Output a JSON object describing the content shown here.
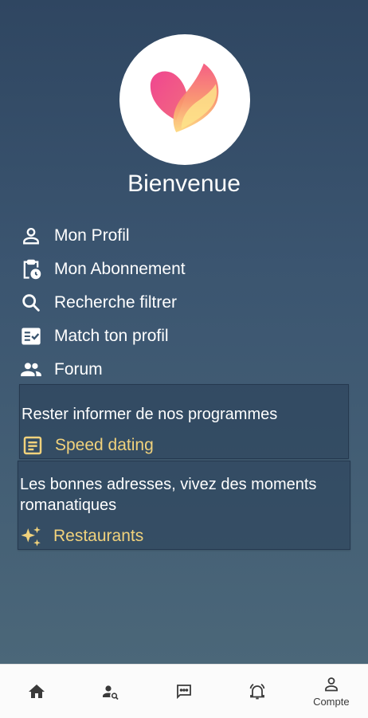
{
  "header": {
    "welcome": "Bienvenue"
  },
  "menu": {
    "items": [
      {
        "label": "Mon Profil",
        "icon": "person-icon"
      },
      {
        "label": "Mon Abonnement",
        "icon": "clipboard-clock-icon"
      },
      {
        "label": "Recherche filtrer",
        "icon": "search-icon"
      },
      {
        "label": "Match ton profil",
        "icon": "fact-check-icon"
      },
      {
        "label": "Forum",
        "icon": "group-icon"
      }
    ]
  },
  "cards": [
    {
      "text": "Rester informer de nos programmes",
      "link": "Speed dating",
      "icon": "article-icon"
    },
    {
      "text": "Les bonnes adresses, vivez des moments romanatiques",
      "link": "Restaurants",
      "icon": "sparkles-icon"
    }
  ],
  "bottom_nav": {
    "items": [
      {
        "icon": "home-icon",
        "label": ""
      },
      {
        "icon": "person-search-icon",
        "label": ""
      },
      {
        "icon": "chat-icon",
        "label": ""
      },
      {
        "icon": "alarm-bell-icon",
        "label": ""
      },
      {
        "icon": "account-icon",
        "label": "Compte"
      }
    ]
  },
  "colors": {
    "background_top": "#2f4661",
    "background_bottom": "#4b6779",
    "accent_link": "#f1d27c",
    "heart_pink": "#f0468f",
    "heart_orange": "#f8a06a",
    "heart_yellow": "#fde38a"
  }
}
